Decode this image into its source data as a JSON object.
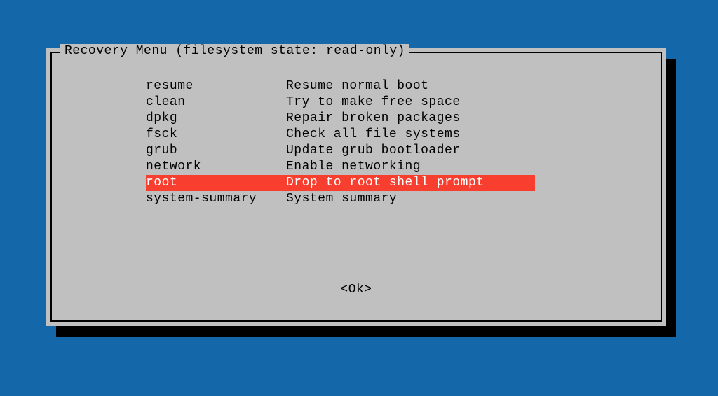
{
  "dialog": {
    "title": "Recovery Menu (filesystem state: read-only)",
    "items": [
      {
        "key": "resume",
        "desc": "Resume normal boot"
      },
      {
        "key": "clean",
        "desc": "Try to make free space"
      },
      {
        "key": "dpkg",
        "desc": "Repair broken packages"
      },
      {
        "key": "fsck",
        "desc": "Check all file systems"
      },
      {
        "key": "grub",
        "desc": "Update grub bootloader"
      },
      {
        "key": "network",
        "desc": "Enable networking"
      },
      {
        "key": "root",
        "desc": "Drop to root shell prompt"
      },
      {
        "key": "system-summary",
        "desc": "System summary"
      }
    ],
    "selected_index": 6,
    "ok_label": "<Ok>"
  }
}
